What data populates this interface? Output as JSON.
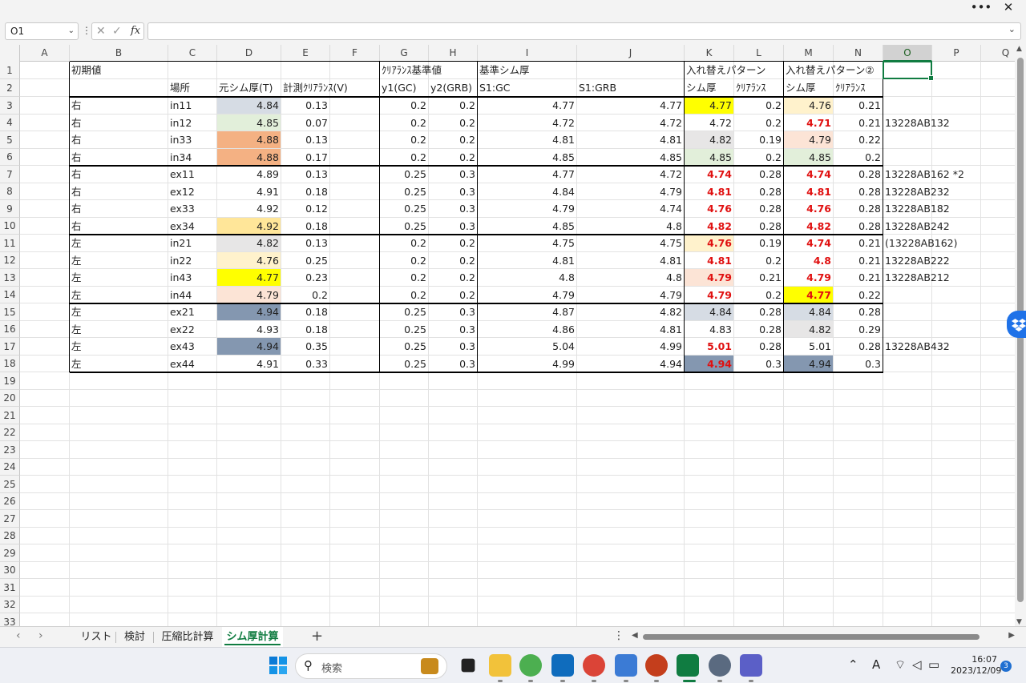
{
  "window": {
    "more_label": "•••",
    "close_label": "✕"
  },
  "formula_bar": {
    "name_box": "O1",
    "cancel_symbol": "✕",
    "enter_symbol": "✓",
    "fx_label": "fx",
    "content": ""
  },
  "sheet": {
    "columns": [
      "A",
      "B",
      "C",
      "D",
      "E",
      "F",
      "G",
      "H",
      "I",
      "J",
      "K",
      "L",
      "M",
      "N",
      "O",
      "P",
      "Q"
    ],
    "rows": [
      "1",
      "2",
      "3",
      "4",
      "5",
      "6",
      "7",
      "8",
      "9",
      "10",
      "11",
      "12",
      "13",
      "14",
      "15",
      "16",
      "17",
      "18",
      "19",
      "20",
      "21",
      "22",
      "23",
      "24",
      "25",
      "26",
      "27",
      "28",
      "29",
      "30",
      "31",
      "32",
      "33"
    ],
    "header_row1": {
      "B": "初期値",
      "G": "ｸﾘｱﾗﾝｽ基準値",
      "I": "基準シム厚",
      "K": "入れ替えパターン",
      "M": "入れ替えパターン②"
    },
    "header_row2": {
      "C": "場所",
      "D": "元シム厚(T)",
      "E": "計測ｸﾘｱﾗﾝｽ(V)",
      "G": "y1(GC)",
      "H": "y2(GRB)",
      "I": "S1:GC",
      "J": "S1:GRB",
      "K": "シム厚",
      "L": "ｸﾘｱﾗﾝｽ",
      "M": "シム厚",
      "N": "ｸﾘｱﾗﾝｽ"
    },
    "data_rows": [
      [
        "右",
        "in11",
        "4.84",
        "0.13",
        "0.2",
        "0.2",
        "4.77",
        "4.77",
        "4.77",
        "0.2",
        "4.76",
        "0.21",
        ""
      ],
      [
        "右",
        "in12",
        "4.85",
        "0.07",
        "0.2",
        "0.2",
        "4.72",
        "4.72",
        "4.72",
        "0.2",
        "4.71",
        "0.21",
        "13228AB132"
      ],
      [
        "右",
        "in33",
        "4.88",
        "0.13",
        "0.2",
        "0.2",
        "4.81",
        "4.81",
        "4.82",
        "0.19",
        "4.79",
        "0.22",
        ""
      ],
      [
        "右",
        "in34",
        "4.88",
        "0.17",
        "0.2",
        "0.2",
        "4.85",
        "4.85",
        "4.85",
        "0.2",
        "4.85",
        "0.2",
        ""
      ],
      [
        "右",
        "ex11",
        "4.89",
        "0.13",
        "0.25",
        "0.3",
        "4.77",
        "4.72",
        "4.74",
        "0.28",
        "4.74",
        "0.28",
        "13228AB162 *2"
      ],
      [
        "右",
        "ex12",
        "4.91",
        "0.18",
        "0.25",
        "0.3",
        "4.84",
        "4.79",
        "4.81",
        "0.28",
        "4.81",
        "0.28",
        "13228AB232"
      ],
      [
        "右",
        "ex33",
        "4.92",
        "0.12",
        "0.25",
        "0.3",
        "4.79",
        "4.74",
        "4.76",
        "0.28",
        "4.76",
        "0.28",
        "13228AB182"
      ],
      [
        "右",
        "ex34",
        "4.92",
        "0.18",
        "0.25",
        "0.3",
        "4.85",
        "4.8",
        "4.82",
        "0.28",
        "4.82",
        "0.28",
        "13228AB242"
      ],
      [
        "左",
        "in21",
        "4.82",
        "0.13",
        "0.2",
        "0.2",
        "4.75",
        "4.75",
        "4.76",
        "0.19",
        "4.74",
        "0.21",
        "(13228AB162)"
      ],
      [
        "左",
        "in22",
        "4.76",
        "0.25",
        "0.2",
        "0.2",
        "4.81",
        "4.81",
        "4.81",
        "0.2",
        "4.8",
        "0.21",
        "13228AB222"
      ],
      [
        "左",
        "in43",
        "4.77",
        "0.23",
        "0.2",
        "0.2",
        "4.8",
        "4.8",
        "4.79",
        "0.21",
        "4.79",
        "0.21",
        "13228AB212"
      ],
      [
        "左",
        "in44",
        "4.79",
        "0.2",
        "0.2",
        "0.2",
        "4.79",
        "4.79",
        "4.79",
        "0.2",
        "4.77",
        "0.22",
        ""
      ],
      [
        "左",
        "ex21",
        "4.94",
        "0.18",
        "0.25",
        "0.3",
        "4.87",
        "4.82",
        "4.84",
        "0.28",
        "4.84",
        "0.28",
        ""
      ],
      [
        "左",
        "ex22",
        "4.93",
        "0.18",
        "0.25",
        "0.3",
        "4.86",
        "4.81",
        "4.83",
        "0.28",
        "4.82",
        "0.29",
        ""
      ],
      [
        "左",
        "ex43",
        "4.94",
        "0.35",
        "0.25",
        "0.3",
        "5.04",
        "4.99",
        "5.01",
        "0.28",
        "5.01",
        "0.28",
        "13228AB432"
      ],
      [
        "左",
        "ex44",
        "4.91",
        "0.33",
        "0.25",
        "0.3",
        "4.99",
        "4.94",
        "4.94",
        "0.3",
        "4.94",
        "0.3",
        ""
      ]
    ],
    "red_K_rows": [
      4,
      5,
      6,
      7,
      8,
      9,
      10,
      11,
      14,
      15,
      16
    ],
    "red_M_rows": [
      1,
      4,
      5,
      6,
      7,
      8,
      9,
      10,
      11,
      16
    ],
    "fills": {
      "D": [
        "#d6dce4",
        "#e2efda",
        "#f4b183",
        "#f4b183",
        "",
        "",
        "",
        "#ffe699",
        "#e7e6e6",
        "#fff2cc",
        "#ffff00",
        "#fce4d6",
        "#8497b0",
        "",
        "#8497b0",
        ""
      ],
      "K": [
        "#ffff00",
        "",
        "#e7e6e6",
        "#e2efda",
        "",
        "",
        "",
        "",
        "#fff2cc",
        "",
        "#fce4d6",
        "",
        "#d6dce4",
        "",
        "",
        "#8497b0"
      ],
      "M": [
        "#fff2cc",
        "",
        "#fce4d6",
        "#e2efda",
        "",
        "",
        "",
        "",
        "",
        "",
        "",
        "#ffff00",
        "#d6dce4",
        "#e7e6e6",
        "",
        "#8497b0"
      ]
    }
  },
  "sheet_tabs": [
    "リスト",
    "検討",
    "圧縮比計算",
    "シム厚計算"
  ],
  "active_tab": "シム厚計算",
  "add_sheet_label": "+",
  "taskbar": {
    "search_placeholder": "検索",
    "time": "16:07",
    "date": "2023/12/09",
    "notification_count": "3",
    "ime_label": "A"
  }
}
